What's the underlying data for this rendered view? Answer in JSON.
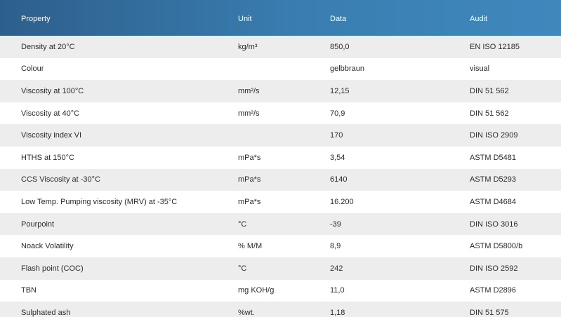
{
  "table": {
    "headers": {
      "property": "Property",
      "unit": "Unit",
      "data": "Data",
      "audit": "Audit"
    },
    "rows": [
      {
        "property": "Density at 20°C",
        "unit": "kg/m³",
        "data": "850,0",
        "audit": "EN ISO 12185"
      },
      {
        "property": "Colour",
        "unit": "",
        "data": "gelbbraun",
        "audit": "visual"
      },
      {
        "property": "Viscosity at 100°C",
        "unit": "mm²/s",
        "data": "12,15",
        "audit": "DIN 51 562"
      },
      {
        "property": "Viscosity at 40°C",
        "unit": "mm²/s",
        "data": "70,9",
        "audit": "DIN 51 562"
      },
      {
        "property": "Viscosity index VI",
        "unit": "",
        "data": "170",
        "audit": "DIN ISO 2909"
      },
      {
        "property": "HTHS at 150°C",
        "unit": "mPa*s",
        "data": "3,54",
        "audit": "ASTM D5481"
      },
      {
        "property": "CCS Viscosity at -30°C",
        "unit": "mPa*s",
        "data": "6140",
        "audit": "ASTM D5293"
      },
      {
        "property": "Low Temp. Pumping viscosity (MRV) at -35°C",
        "unit": "mPa*s",
        "data": "16.200",
        "audit": "ASTM D4684"
      },
      {
        "property": "Pourpoint",
        "unit": "°C",
        "data": "-39",
        "audit": "DIN ISO 3016"
      },
      {
        "property": "Noack Volatility",
        "unit": "% M/M",
        "data": "8,9",
        "audit": "ASTM D5800/b"
      },
      {
        "property": "Flash point (COC)",
        "unit": "°C",
        "data": "242",
        "audit": "DIN ISO 2592"
      },
      {
        "property": "TBN",
        "unit": "mg KOH/g",
        "data": "11,0",
        "audit": "ASTM D2896"
      },
      {
        "property": "Sulphated ash",
        "unit": "%wt.",
        "data": "1,18",
        "audit": "DIN 51 575"
      }
    ]
  }
}
